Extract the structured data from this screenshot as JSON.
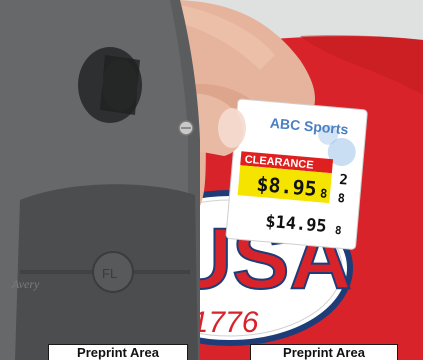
{
  "label": {
    "brand": "ABC Sports",
    "tag": "CLEARANCE",
    "sale_price": "$8.95",
    "sale_code": "8",
    "side_code_top": "2",
    "side_code_bottom": "8",
    "orig_price": "$14.95",
    "orig_code": "8"
  },
  "tool": {
    "brand_mark": "Avery"
  },
  "patch": {
    "word": "USA",
    "year": "Est.1776"
  },
  "callouts": [
    {
      "text": "Preprint Area"
    },
    {
      "text": "Preprint Area"
    }
  ],
  "colors": {
    "shirt": "#d8232a",
    "gun": "#5a5c5e",
    "label_yellow": "#f5e400",
    "label_red": "#e02020",
    "brand_blue": "#4a7fc1"
  }
}
